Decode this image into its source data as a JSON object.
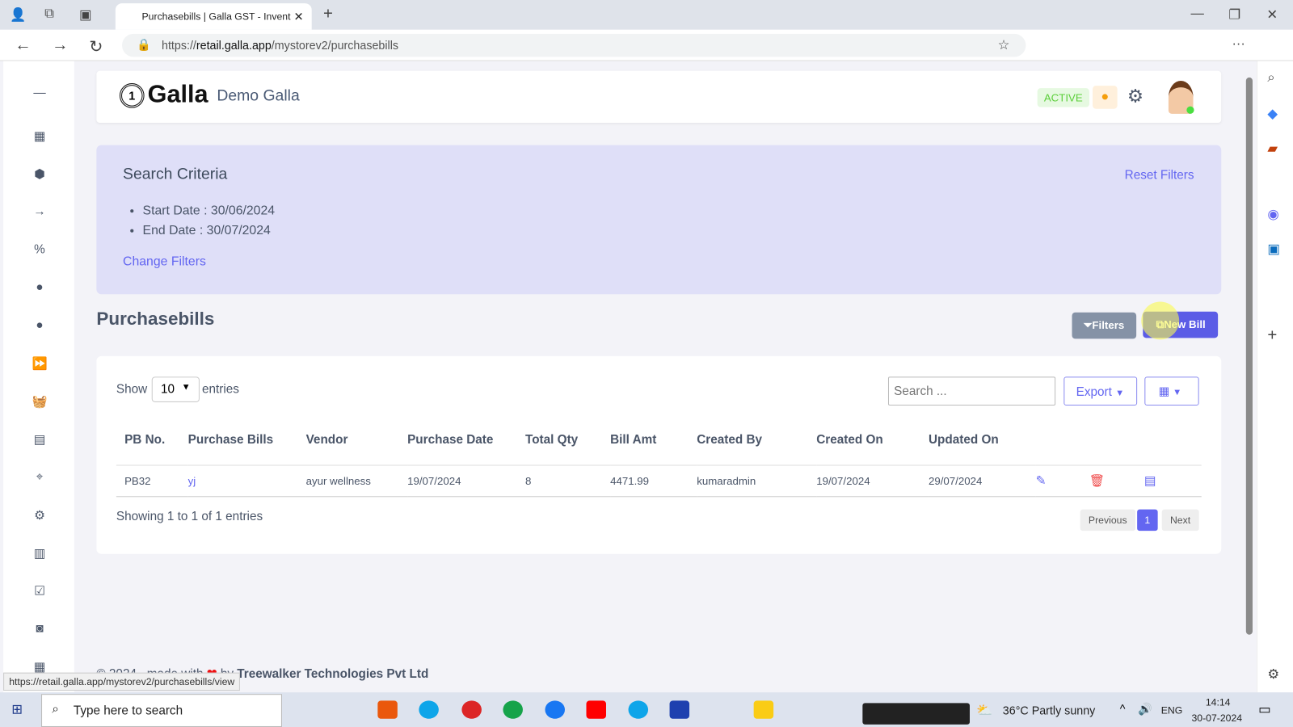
{
  "browser": {
    "tab_title": "Purchasebills | Galla GST - Invent",
    "url_prefix": "https://",
    "url_domain": "retail.galla.app",
    "url_path": "/mystorev2/purchasebills",
    "status_url": "https://retail.galla.app/mystorev2/purchasebills/view"
  },
  "header": {
    "logo": "Galla",
    "store_name": "Demo Galla",
    "status_badge": "ACTIVE"
  },
  "search_criteria": {
    "title": "Search Criteria",
    "reset": "Reset Filters",
    "items": [
      "Start Date : 30/06/2024",
      "End Date : 30/07/2024"
    ],
    "change": "Change Filters"
  },
  "page": {
    "title": "Purchasebills",
    "filters_button": "Filters",
    "new_bill_button": "New Bill"
  },
  "table_controls": {
    "show": "Show",
    "entries_value": "10",
    "entries": "entries",
    "search_placeholder": "Search ...",
    "export": "Export"
  },
  "table": {
    "columns": [
      "PB No.",
      "Purchase Bills",
      "Vendor",
      "Purchase Date",
      "Total Qty",
      "Bill Amt",
      "Created By",
      "Created On",
      "Updated On"
    ],
    "rows": [
      {
        "pb_no": "PB32",
        "bill": "yj",
        "vendor": "ayur wellness",
        "purchase_date": "19/07/2024",
        "qty": "8",
        "amount": "4471.99",
        "created_by": "kumaradmin",
        "created_on": "19/07/2024",
        "updated_on": "29/07/2024"
      }
    ]
  },
  "pagination": {
    "info": "Showing 1 to 1 of 1 entries",
    "previous": "Previous",
    "current": "1",
    "next": "Next"
  },
  "footer": {
    "text": "© 2024 , made with",
    "heart": "❤",
    "by": "by",
    "company": "Treewalker Technologies Pvt Ltd"
  },
  "taskbar": {
    "search": "Type here to search",
    "weather": "36°C  Partly sunny",
    "lang": "ENG",
    "time": "14:14",
    "date": "30-07-2024"
  },
  "colors": {
    "accent": "#6366f1",
    "active_badge": "#e6f9e1",
    "search_bg": "#dfdff8"
  }
}
